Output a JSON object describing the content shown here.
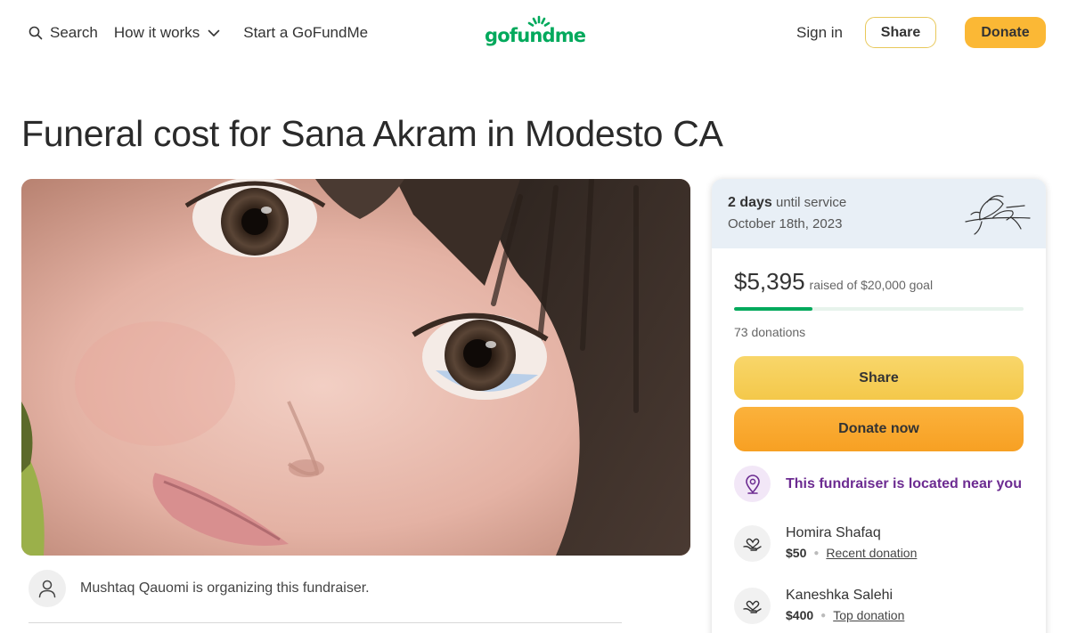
{
  "nav": {
    "search_label": "Search",
    "how_it_works_label": "How it works",
    "start_label": "Start a GoFundMe",
    "logo_text": "gofundme",
    "sign_in_label": "Sign in",
    "share_label": "Share",
    "donate_label": "Donate"
  },
  "page": {
    "title": "Funeral cost for Sana Akram in Modesto CA"
  },
  "organizer": {
    "text": "Mushtaq Qauomi is organizing this fundraiser."
  },
  "service": {
    "days": "2 days",
    "until_text": "until service",
    "date": "October 18th, 2023"
  },
  "fundraiser": {
    "raised": "$5,395",
    "goal_text": "raised of $20,000 goal",
    "progress_fraction": 0.27,
    "donations_count": "73 donations",
    "share_button": "Share",
    "donate_button": "Donate now",
    "nearby_text": "This fundraiser is located near you"
  },
  "donors": [
    {
      "name": "Homira Shafaq",
      "amount": "$50",
      "tag": "Recent donation"
    },
    {
      "name": "Kaneshka Salehi",
      "amount": "$400",
      "tag": "Top donation"
    }
  ],
  "colors": {
    "brand_green": "#02a95c",
    "donate_orange": "#f7a023",
    "share_yellow": "#f4c84a",
    "nearby_purple": "#6c2b91"
  },
  "icons": {
    "search": "search-icon",
    "chevron": "chevron-down-icon",
    "avatar": "user-avatar-icon",
    "location": "location-pin-icon",
    "donor": "heart-hand-icon",
    "service": "flower-sketch-icon"
  }
}
